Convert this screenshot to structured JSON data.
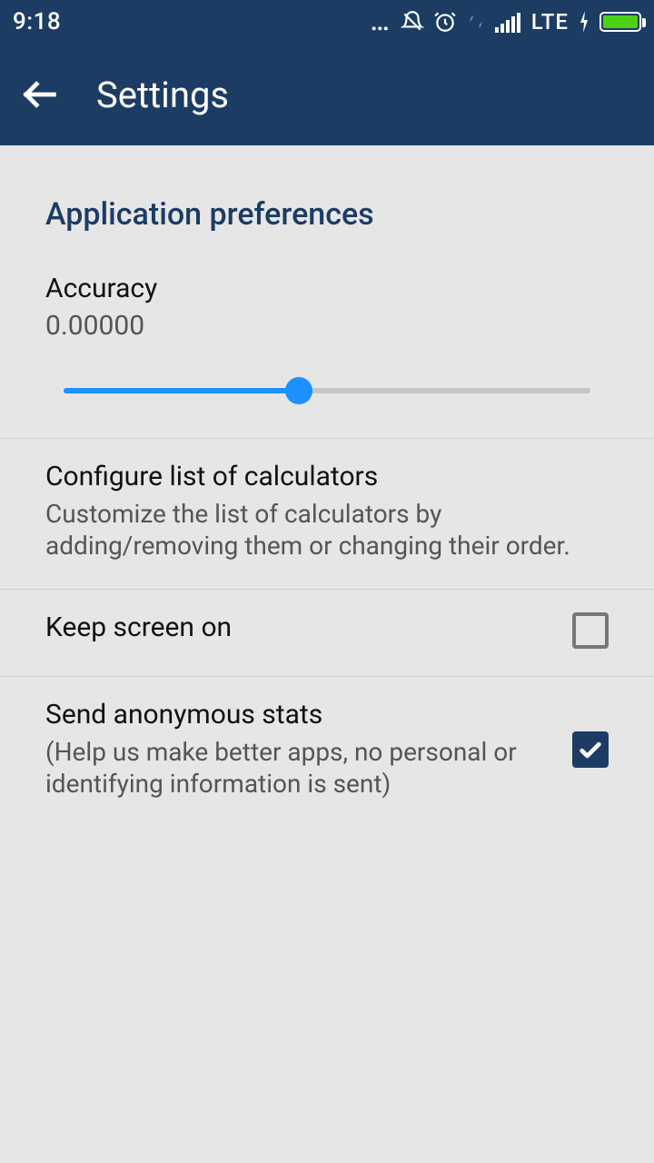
{
  "status": {
    "time": "9:18",
    "network_label": "LTE"
  },
  "appbar": {
    "title": "Settings"
  },
  "section": {
    "header": "Application preferences"
  },
  "accuracy": {
    "title": "Accuracy",
    "value": "0.00000",
    "slider_percent": 45
  },
  "configure": {
    "title": "Configure list of calculators",
    "summary": "Customize the list of calculators by adding/removing them or changing their order."
  },
  "keepscreen": {
    "title": "Keep screen on",
    "checked": false
  },
  "stats": {
    "title": "Send anonymous stats",
    "summary": "(Help us make better apps, no personal or identifying information is sent)",
    "checked": true
  }
}
